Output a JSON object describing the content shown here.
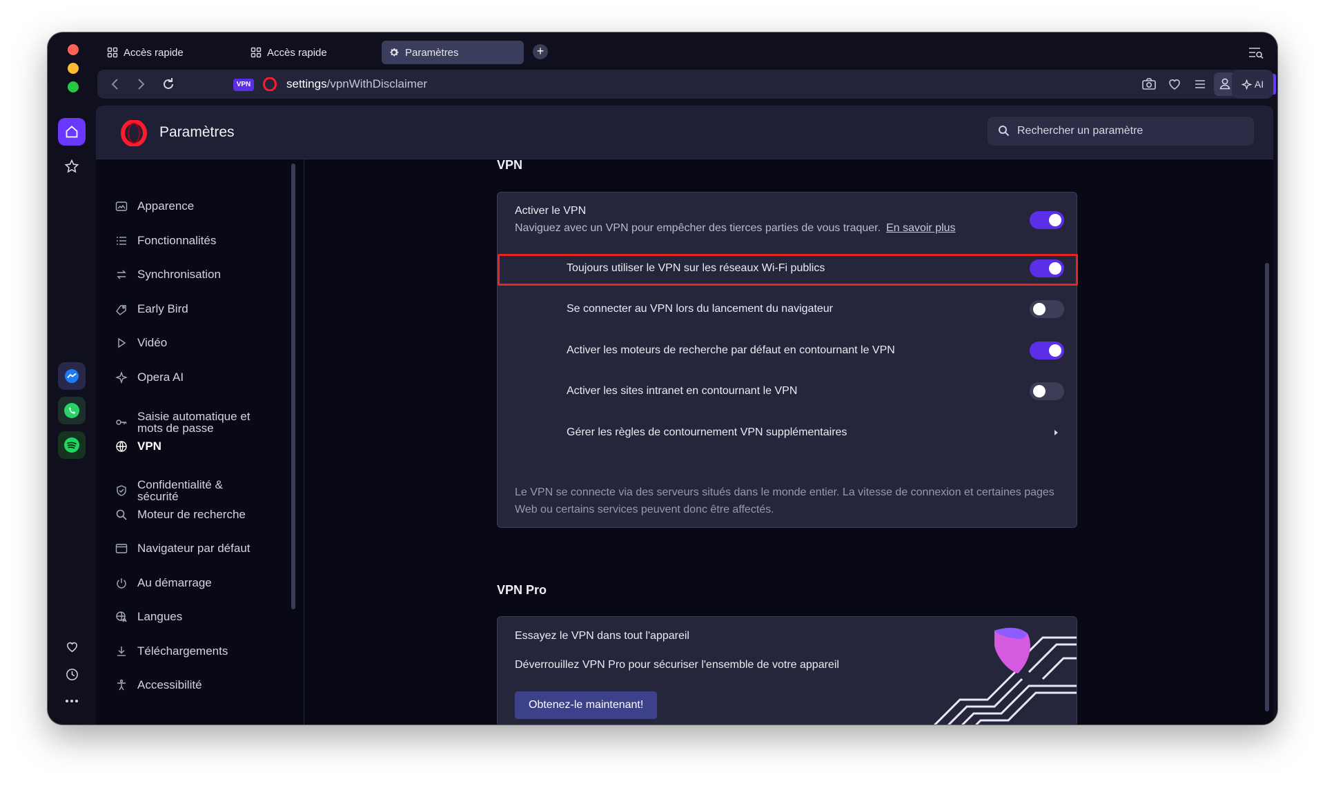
{
  "window": {
    "title": "Paramètres"
  },
  "tabs": [
    {
      "label": "Accès rapide",
      "icon": "grid-icon",
      "active": false
    },
    {
      "label": "Accès rapide",
      "icon": "grid-icon",
      "active": false
    },
    {
      "label": "Paramètres",
      "icon": "gear-icon",
      "active": true
    }
  ],
  "address": {
    "vpn_badge": "VPN",
    "url_host": "settings",
    "url_path": "/vpnWithDisclaimer"
  },
  "toolbar": {
    "ai_label": "AI"
  },
  "header": {
    "title": "Paramètres",
    "search_placeholder": "Rechercher un paramètre"
  },
  "nav": {
    "items": [
      {
        "label": "Apparence",
        "icon": "appearance-icon"
      },
      {
        "label": "Fonctionnalités",
        "icon": "list-icon"
      },
      {
        "label": "Synchronisation",
        "icon": "sync-icon"
      },
      {
        "label": "Early Bird",
        "icon": "early-bird-icon"
      },
      {
        "label": "Vidéo",
        "icon": "play-icon"
      },
      {
        "label": "Opera AI",
        "icon": "sparkle-icon"
      },
      {
        "label": "Saisie automatique et mots de passe",
        "icon": "key-icon"
      },
      {
        "label": "VPN",
        "icon": "vpn-icon",
        "active": true
      },
      {
        "label": "Confidentialité & sécurité",
        "icon": "shield-icon"
      },
      {
        "label": "Moteur de recherche",
        "icon": "search-icon"
      },
      {
        "label": "Navigateur par défaut",
        "icon": "browser-icon"
      },
      {
        "label": "Au démarrage",
        "icon": "power-icon"
      },
      {
        "label": "Langues",
        "icon": "language-icon"
      },
      {
        "label": "Téléchargements",
        "icon": "download-icon"
      },
      {
        "label": "Accessibilité",
        "icon": "accessibility-icon"
      }
    ]
  },
  "vpn": {
    "section_title": "VPN",
    "enable": {
      "label": "Activer le VPN",
      "description": "Naviguez avec un VPN pour empêcher des tierces parties de vous traquer.",
      "link": "En savoir plus",
      "on": true
    },
    "options": [
      {
        "label": "Toujours utiliser le VPN sur les réseaux Wi-Fi publics",
        "on": true
      },
      {
        "label": "Se connecter au VPN lors du lancement du navigateur",
        "on": false
      },
      {
        "label": "Activer les moteurs de recherche par défaut en contournant le VPN",
        "on": true
      },
      {
        "label": "Activer les sites intranet en contournant le VPN",
        "on": false
      }
    ],
    "rules_link": "Gérer les règles de contournement VPN supplémentaires",
    "note": "Le VPN se connecte via des serveurs situés dans le monde entier. La vitesse de connexion et certaines pages Web ou certains services peuvent donc être affectés."
  },
  "vpn_pro": {
    "section_title": "VPN Pro",
    "title": "Essayez le VPN dans tout l'appareil",
    "description": "Déverrouillez VPN Pro pour sécuriser l'ensemble de votre appareil",
    "cta": "Obtenez-le maintenant!"
  },
  "colors": {
    "accent": "#5b2ee8",
    "highlight": "#e8261f",
    "background": "#090915",
    "card": "#25263c"
  }
}
